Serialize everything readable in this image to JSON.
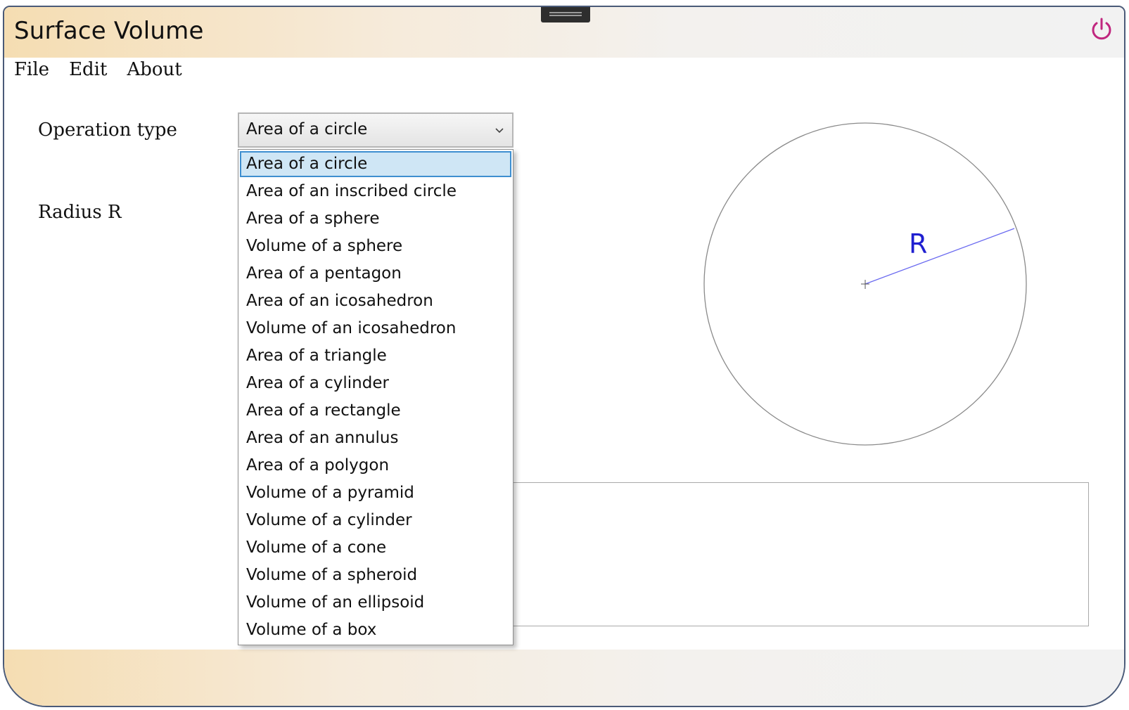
{
  "window": {
    "title": "Surface Volume",
    "accent_color": "#c0277f"
  },
  "menu": {
    "items": [
      "File",
      "Edit",
      "About"
    ]
  },
  "form": {
    "operation_label": "Operation type",
    "radius_label": "Radius R",
    "selected_operation": "Area of a circle"
  },
  "dropdown": {
    "options": [
      "Area of a circle",
      "Area of an inscribed circle",
      "Area of a sphere",
      "Volume of a sphere",
      "Area of a pentagon",
      "Area of an icosahedron",
      "Volume of an icosahedron",
      "Area of a triangle",
      "Area of a cylinder",
      "Area of a rectangle",
      "Area of an annulus",
      "Area of a polygon",
      "Volume of a pyramid",
      "Volume of a cylinder",
      "Volume of a cone",
      "Volume of a spheroid",
      "Volume of an ellipsoid",
      "Volume of a box"
    ],
    "selected_index": 0
  },
  "figure": {
    "radius_label": "R",
    "radius_color": "#1f1fd0"
  }
}
